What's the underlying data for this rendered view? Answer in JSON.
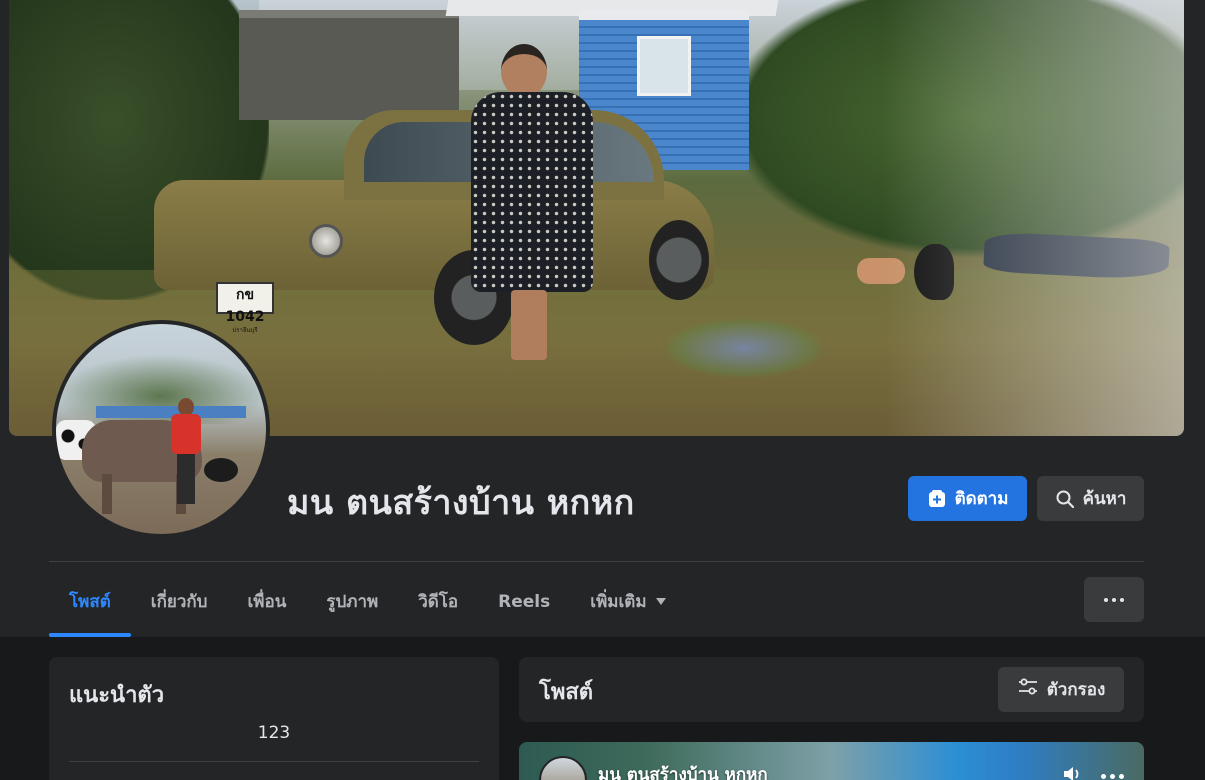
{
  "profile": {
    "name": "มน ตนสร้างบ้าน หกหก",
    "follow_label": "ติดตาม",
    "search_label": "ค้นหา"
  },
  "cover_photo": {
    "license_plate": "กข 1042",
    "plate_province": "ปราจีนบุรี"
  },
  "tabs": [
    {
      "label": "โพสต์",
      "active": true
    },
    {
      "label": "เกี่ยวกับ",
      "active": false
    },
    {
      "label": "เพื่อน",
      "active": false
    },
    {
      "label": "รูปภาพ",
      "active": false
    },
    {
      "label": "วิดีโอ",
      "active": false
    },
    {
      "label": "Reels",
      "active": false
    },
    {
      "label": "เพิ่มเติม",
      "active": false
    }
  ],
  "intro": {
    "title": "แนะนำตัว",
    "bio": "123"
  },
  "posts": {
    "title": "โพสต์",
    "filter_label": "ตัวกรอง"
  },
  "post_preview": {
    "author": "มน ตนสร้างบ้าน หกหก"
  },
  "colors": {
    "accent": "#2374e1",
    "active_tab": "#2d88ff",
    "background": "#18191a",
    "surface": "#242526",
    "button_secondary": "#3a3b3c"
  },
  "icons": {
    "follow": "add-person-icon",
    "search": "search-icon",
    "more": "more-dots-icon",
    "filter": "filter-sliders-icon",
    "dropdown": "caret-down-icon"
  }
}
